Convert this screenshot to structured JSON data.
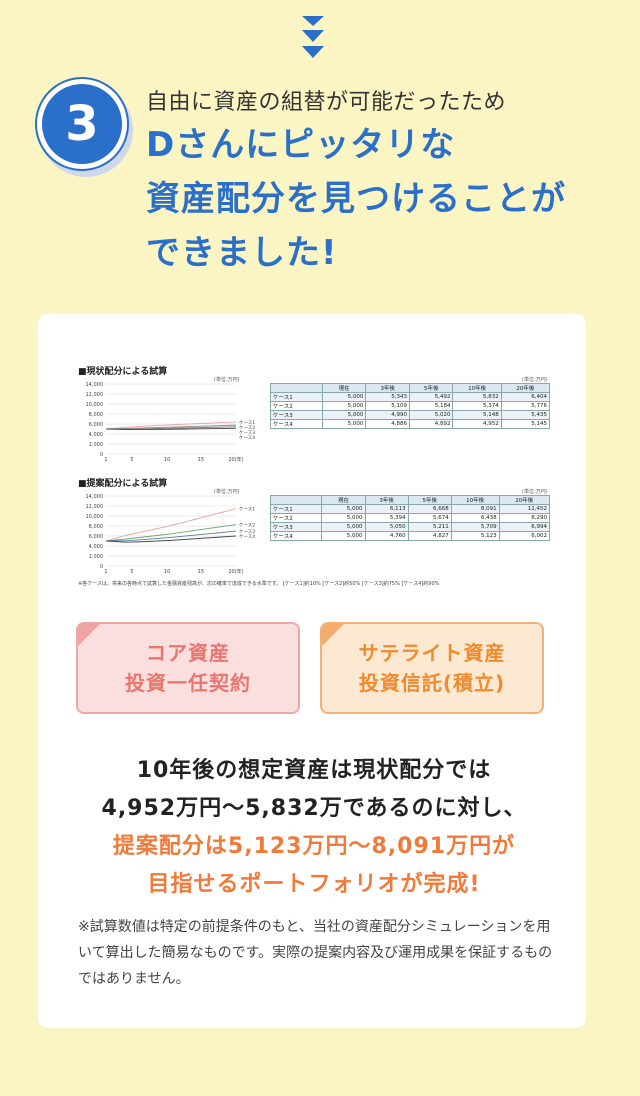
{
  "step": {
    "number": "3",
    "lead": "自由に資産の組替が可能だったため",
    "headline_lines": [
      "Dさんにピッタリな",
      "資産配分を見つけることが",
      "できました!"
    ]
  },
  "colors": {
    "accent_blue": "#2a6fc9",
    "accent_orange": "#ef7a3a",
    "background": "#fbf4c3"
  },
  "icons": {
    "down-chevrons": "triple-down-chevron"
  },
  "current": {
    "title": "■現状配分による試算",
    "unit": "(単位:万円)",
    "table_unit": "(単位:万円)",
    "yticks": [
      "14,000",
      "12,000",
      "10,000",
      "8,000",
      "6,000",
      "4,000",
      "2,000",
      "0"
    ],
    "xticks": [
      "1",
      "5",
      "10",
      "15",
      "20(年)"
    ],
    "legend": [
      "ケース1",
      "ケース2",
      "ケース3",
      "ケース4"
    ],
    "headers": [
      "",
      "現在",
      "3年後",
      "5年後",
      "10年後",
      "20年後"
    ],
    "rows": [
      [
        "ケース1",
        "5,000",
        "5,343",
        "5,492",
        "5,832",
        "6,404"
      ],
      [
        "ケース2",
        "5,000",
        "5,109",
        "5,184",
        "5,374",
        "5,776"
      ],
      [
        "ケース3",
        "5,000",
        "4,990",
        "5,020",
        "5,148",
        "5,435"
      ],
      [
        "ケース4",
        "5,000",
        "4,886",
        "4,892",
        "4,952",
        "5,145"
      ]
    ]
  },
  "proposed": {
    "title": "■提案配分による試算",
    "unit": "(単位:万円)",
    "table_unit": "(単位:万円)",
    "yticks": [
      "14,000",
      "12,000",
      "10,000",
      "8,000",
      "6,000",
      "4,000",
      "2,000",
      "0"
    ],
    "xticks": [
      "1",
      "5",
      "10",
      "15",
      "20(年)"
    ],
    "legend": [
      "ケース1",
      "ケース2",
      "ケース3",
      "ケース4"
    ],
    "headers": [
      "",
      "現在",
      "3年後",
      "5年後",
      "10年後",
      "20年後"
    ],
    "rows": [
      [
        "ケース1",
        "5,000",
        "6,113",
        "6,668",
        "8,091",
        "11,452"
      ],
      [
        "ケース2",
        "5,000",
        "5,394",
        "5,674",
        "6,438",
        "8,290"
      ],
      [
        "ケース3",
        "5,000",
        "5,050",
        "5,211",
        "5,709",
        "6,994"
      ],
      [
        "ケース4",
        "5,000",
        "4,760",
        "4,827",
        "5,123",
        "6,002"
      ]
    ]
  },
  "chart_footnote": "※各ケースは、将来の各時点で試算した金融資産残高が、次の確率で達成できる水準です。 [ケース1]約10% [ケース2]約50% [ケース3]約75% [ケース4]約90%",
  "tags": {
    "core": [
      "コア資産",
      "投資一任契約"
    ],
    "satellite": [
      "サテライト資産",
      "投資信託(積立)"
    ]
  },
  "summary": {
    "line1": "10年後の想定資産は現状配分では",
    "line2": "4,952万円〜5,832万であるのに対し、",
    "line3": "提案配分は5,123万円〜8,091万円が",
    "line4": "目指せるポートフォリオが完成!"
  },
  "disclaimer": "※試算数値は特定の前提条件のもと、当社の資産配分シミュレーションを用いて算出した簡易なものです。実際の提案内容及び運用成果を保証するものではありません。"
}
